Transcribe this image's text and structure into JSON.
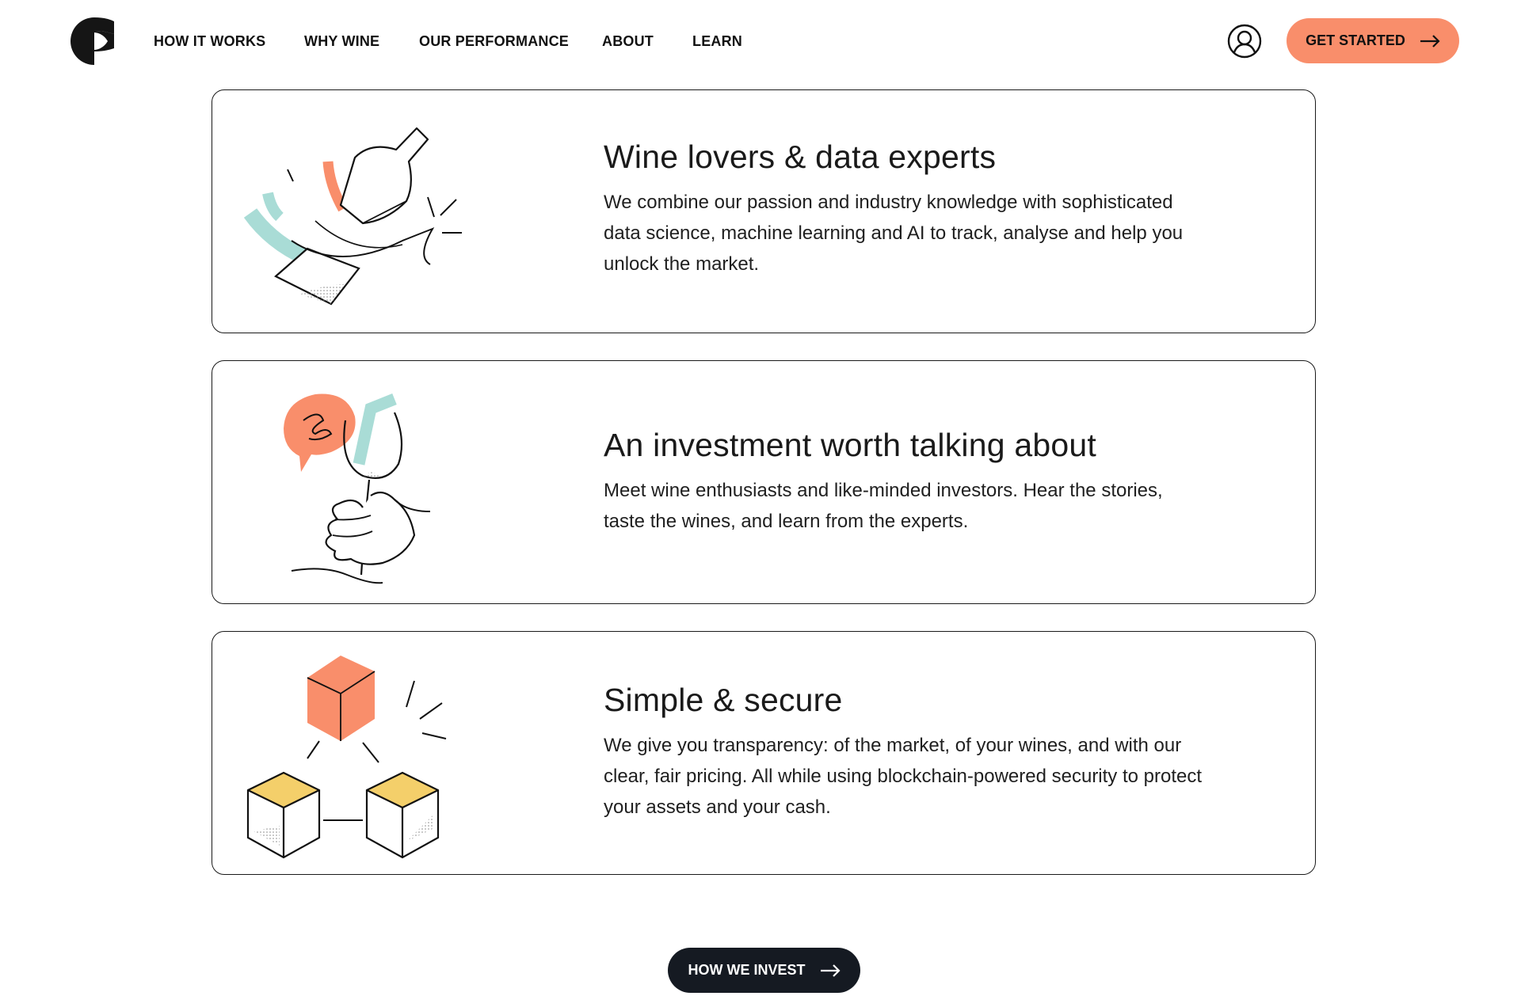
{
  "nav": {
    "items": [
      {
        "label": "HOW IT WORKS"
      },
      {
        "label": "WHY WINE"
      },
      {
        "label": "OUR PERFORMANCE"
      },
      {
        "label": "ABOUT"
      },
      {
        "label": "LEARN"
      }
    ]
  },
  "header": {
    "cta_label": "GET STARTED",
    "account_icon": "user-circle-icon",
    "logo_icon": "brand-logo"
  },
  "cards": [
    {
      "title": "Wine lovers & data experts",
      "body": "We combine our passion and industry knowledge with sophisticated data science, machine learning and AI to track, analyse and help you unlock the market.",
      "icon": "wine-bottle-pour-icon"
    },
    {
      "title": "An investment worth talking about",
      "body": "Meet wine enthusiasts and like-minded investors. Hear the stories, taste the wines, and learn from the experts.",
      "icon": "wine-glass-hand-icon"
    },
    {
      "title": "Simple & secure",
      "body": "We give you transparency: of the market, of your wines, and with our clear, fair pricing. All while using blockchain-powered security to protect your assets and your cash.",
      "icon": "blockchain-cubes-icon"
    }
  ],
  "bottom_cta": {
    "label": "HOW WE INVEST"
  },
  "colors": {
    "accent_orange": "#f98e6b",
    "accent_teal": "#a9dcd6",
    "accent_yellow": "#f4cf6a",
    "dark_button": "#151a22",
    "text": "#111111"
  }
}
